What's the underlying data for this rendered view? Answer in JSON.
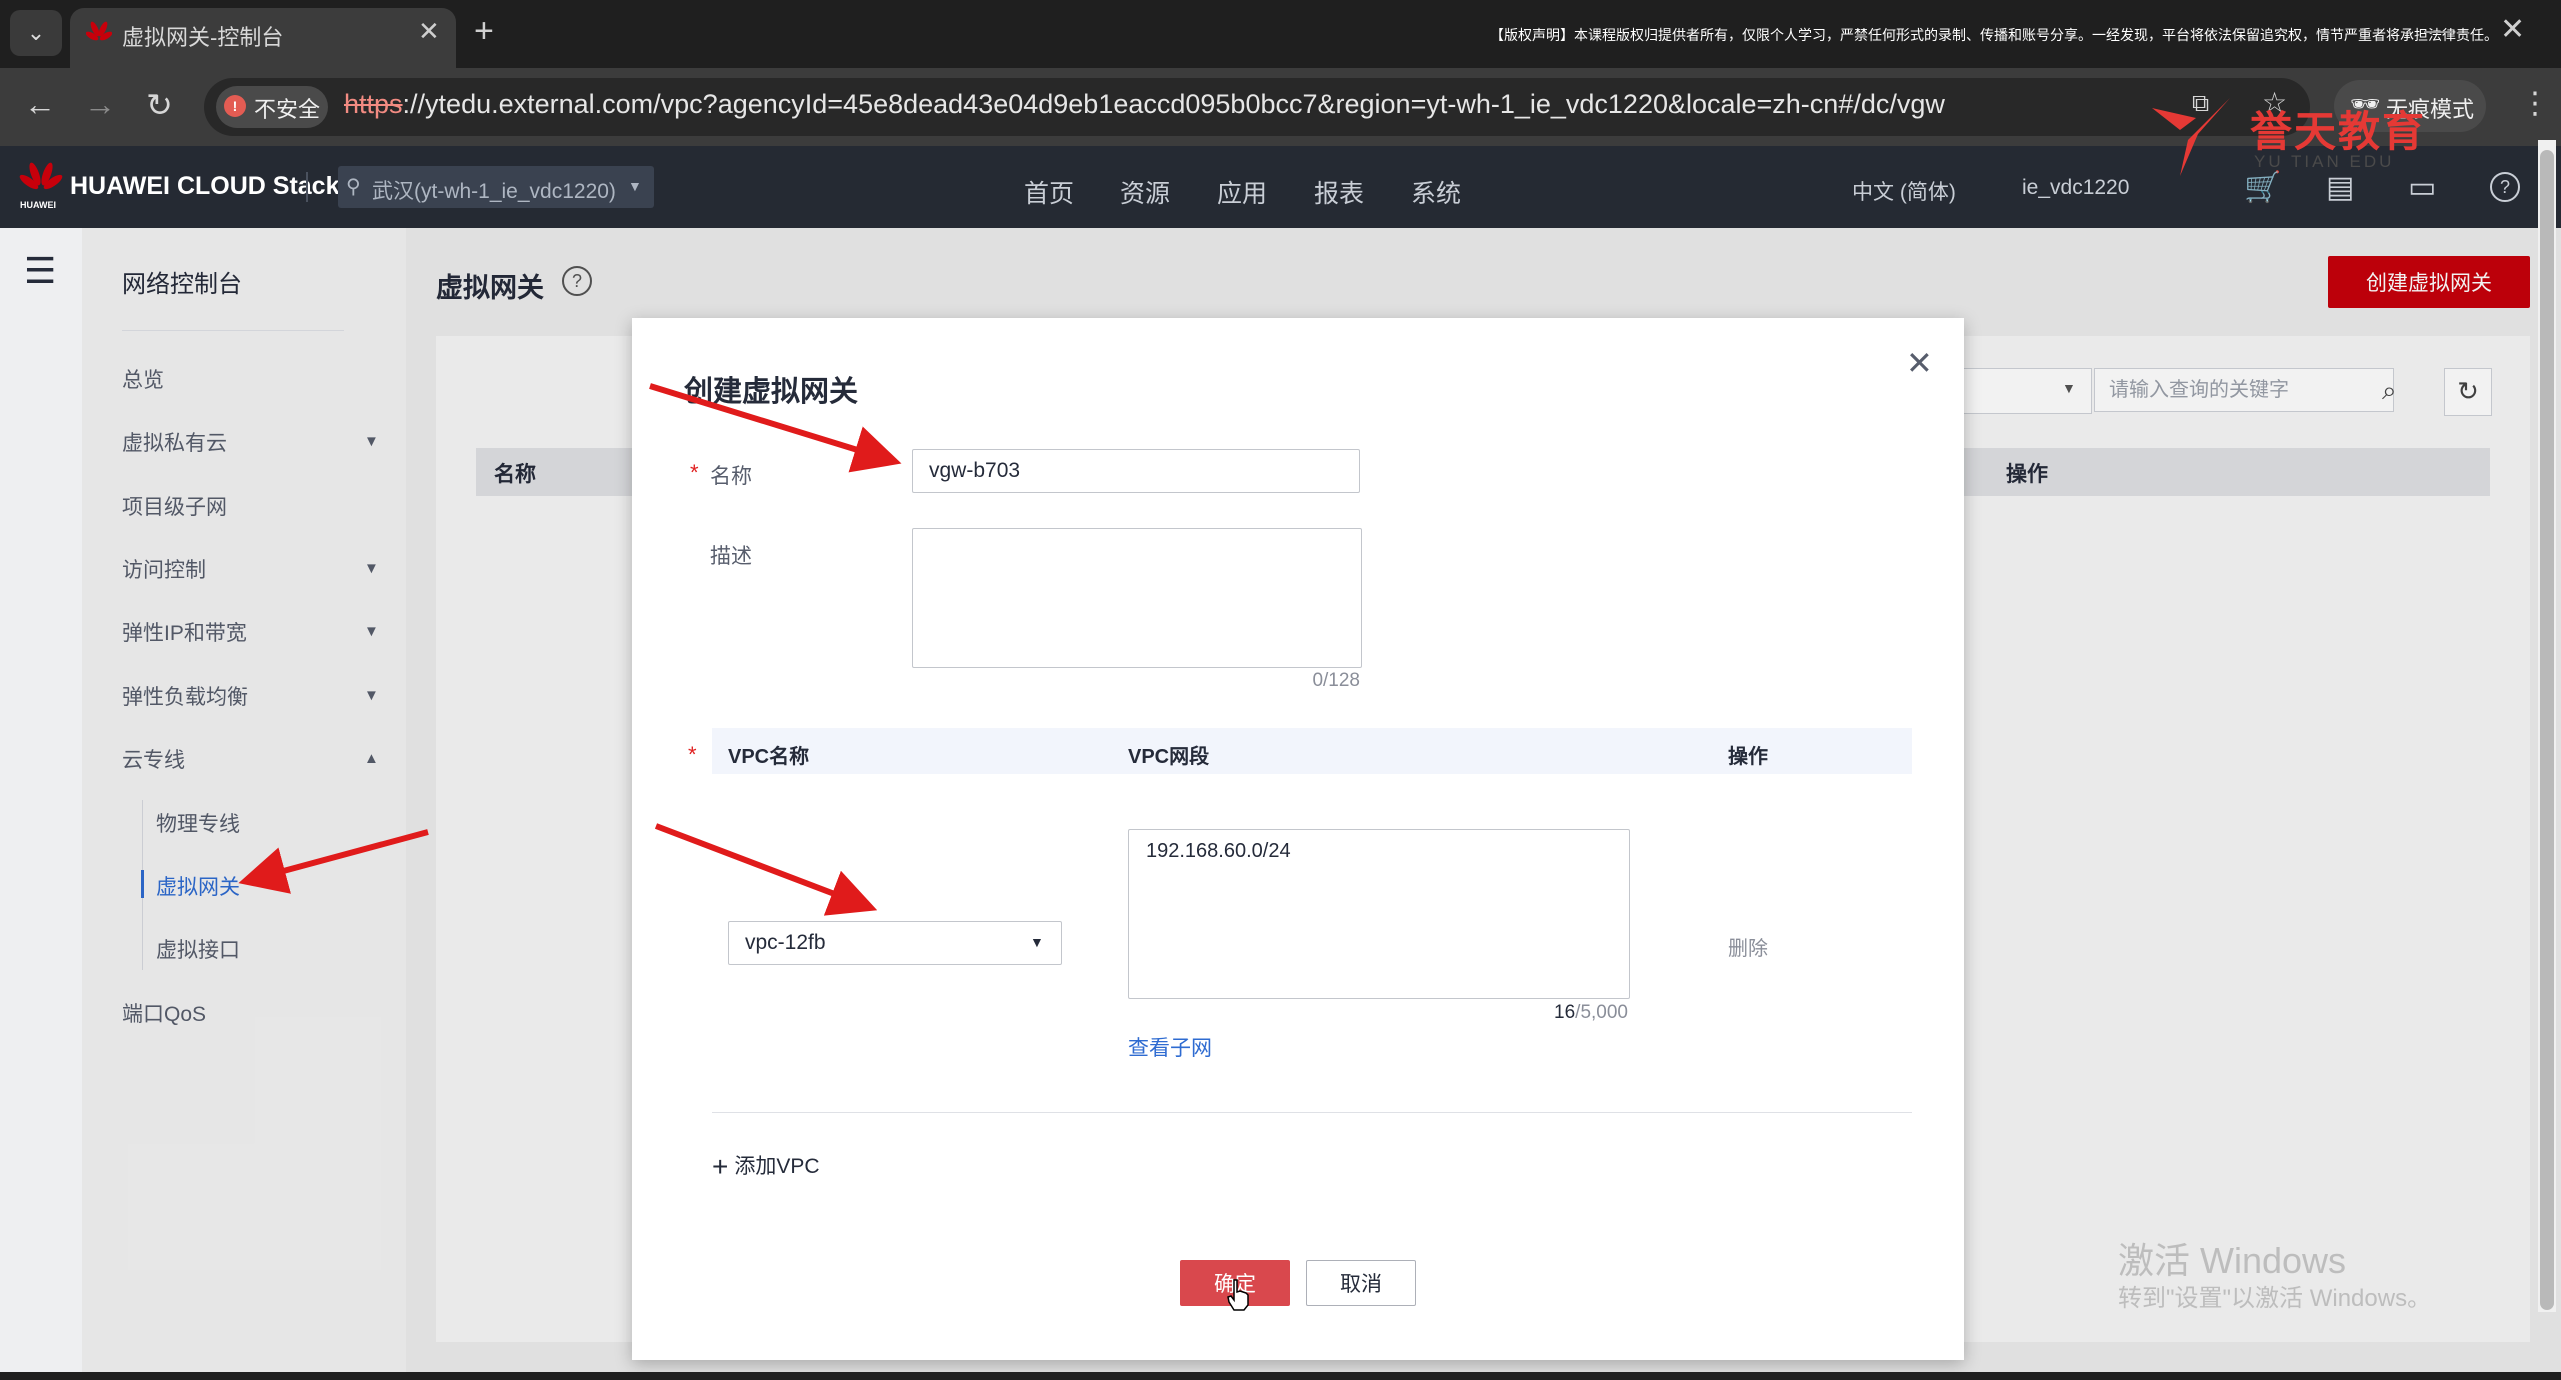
{
  "browser": {
    "tab_title": "虚拟网关-控制台",
    "notice": "【版权声明】本课程版权归提供者所有，仅限个人学习，严禁任何形式的录制、传播和账号分享。一经发现，平台将依法保留追究权，情节严重者将承担法律责任。",
    "insecure_label": "不安全",
    "url_scheme": "https",
    "url_rest": "://ytedu.external.com/vpc?agencyId=45e8dead43e04d9eb1eaccd095b0bcc7&region=yt-wh-1_ie_vdc1220&locale=zh-cn#/dc/vgw",
    "incognito_label": "无痕模式"
  },
  "watermark": {
    "brand": "誉天教育",
    "brand_sub": "YU TIAN EDU",
    "windows_line1": "激活 Windows",
    "windows_line2": "转到\"设置\"以激活 Windows。"
  },
  "header": {
    "logo": "HUAWEI CLOUD Stack",
    "logo_sub": "HUAWEI",
    "region": "武汉(yt-wh-1_ie_vdc1220)",
    "nav": [
      "首页",
      "资源",
      "应用",
      "报表",
      "系统"
    ],
    "language": "中文 (简体)",
    "user": "ie_vdc1220"
  },
  "sidebar": {
    "title": "网络控制台",
    "items": [
      "总览",
      "虚拟私有云",
      "项目级子网",
      "访问控制",
      "弹性IP和带宽",
      "弹性负载均衡",
      "云专线",
      "端口QoS"
    ],
    "sub_items": [
      "物理专线",
      "虚拟网关",
      "虚拟接口"
    ]
  },
  "page": {
    "title": "虚拟网关",
    "create_button": "创建虚拟网关",
    "search_placeholder": "请输入查询的关键字",
    "col_name": "名称",
    "col_ops": "操作"
  },
  "dialog": {
    "title": "创建虚拟网关",
    "name_label": "名称",
    "name_value": "vgw-b703",
    "desc_label": "描述",
    "desc_counter": "0/128",
    "vpc_col_name": "VPC名称",
    "vpc_col_cidr": "VPC网段",
    "vpc_col_ops": "操作",
    "vpc_selected": "vpc-12fb",
    "vpc_cidr": "192.168.60.0/24",
    "cidr_counter_used": "16",
    "cidr_counter_max": "/5,000",
    "view_subnet": "查看子网",
    "delete": "删除",
    "add_vpc": "添加VPC",
    "ok": "确定",
    "cancel": "取消"
  }
}
